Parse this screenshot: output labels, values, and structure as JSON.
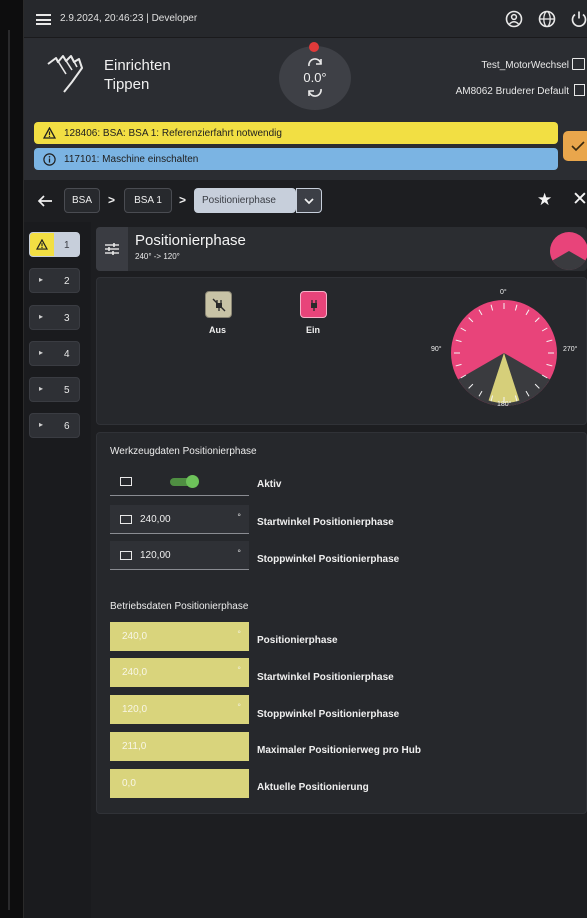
{
  "topbar": {
    "status_text": "2.9.2024, 20:46:23 | Developer",
    "icons": [
      "menu-icon",
      "user-icon",
      "globe-icon",
      "power-icon"
    ]
  },
  "header": {
    "mode_line1": "Einrichten",
    "mode_line2": "Tippen",
    "dial_value": "0.0°",
    "project_name": "Test_MotorWechsel",
    "config_name": "AM8062 Bruderer Default"
  },
  "alarms": [
    {
      "type": "warning",
      "text": "128406: BSA: BSA 1: Referenzierfahrt notwendig",
      "color": "#f2df43"
    },
    {
      "type": "info",
      "text": "117101: Maschine einschalten",
      "color": "#7bb4e3"
    }
  ],
  "breadcrumb": {
    "items": [
      "BSA",
      "BSA 1"
    ],
    "current": "Positionierphase"
  },
  "steps": [
    {
      "label": "1",
      "state": "warning"
    },
    {
      "label": "2"
    },
    {
      "label": "3"
    },
    {
      "label": "4"
    },
    {
      "label": "5"
    },
    {
      "label": "6"
    }
  ],
  "section": {
    "title": "Positionierphase",
    "subtitle": "240° -> 120°"
  },
  "power": {
    "off_label": "Aus",
    "on_label": "Ein"
  },
  "phase_diagram": {
    "label_0": "0°",
    "label_90": "90°",
    "label_180": "180°",
    "label_270": "270°",
    "start_angle": 240,
    "stop_angle": 120,
    "colors": {
      "phase": "#e8447a",
      "remaining": "#3a3b3f",
      "tool": "#d6cf7a"
    }
  },
  "werkzeugdaten": {
    "title": "Werkzeugdaten Positionierphase",
    "active_label": "Aktiv",
    "active": true,
    "fields": [
      {
        "value": "240,00",
        "unit": "°",
        "label": "Startwinkel Positionierphase"
      },
      {
        "value": "120,00",
        "unit": "°",
        "label": "Stoppwinkel Positionierphase"
      }
    ]
  },
  "betriebsdaten": {
    "title": "Betriebsdaten Positionierphase",
    "fields": [
      {
        "value": "240,0",
        "unit": "°",
        "label": "Positionierphase"
      },
      {
        "value": "240,0",
        "unit": "°",
        "label": "Startwinkel Positionierphase"
      },
      {
        "value": "120,0",
        "unit": "°",
        "label": "Stoppwinkel Positionierphase"
      },
      {
        "value": "211,0",
        "unit": "",
        "label": "Maximaler Positionierweg pro Hub"
      },
      {
        "value": "0,0",
        "unit": "",
        "label": "Aktuelle Positionierung"
      }
    ]
  }
}
